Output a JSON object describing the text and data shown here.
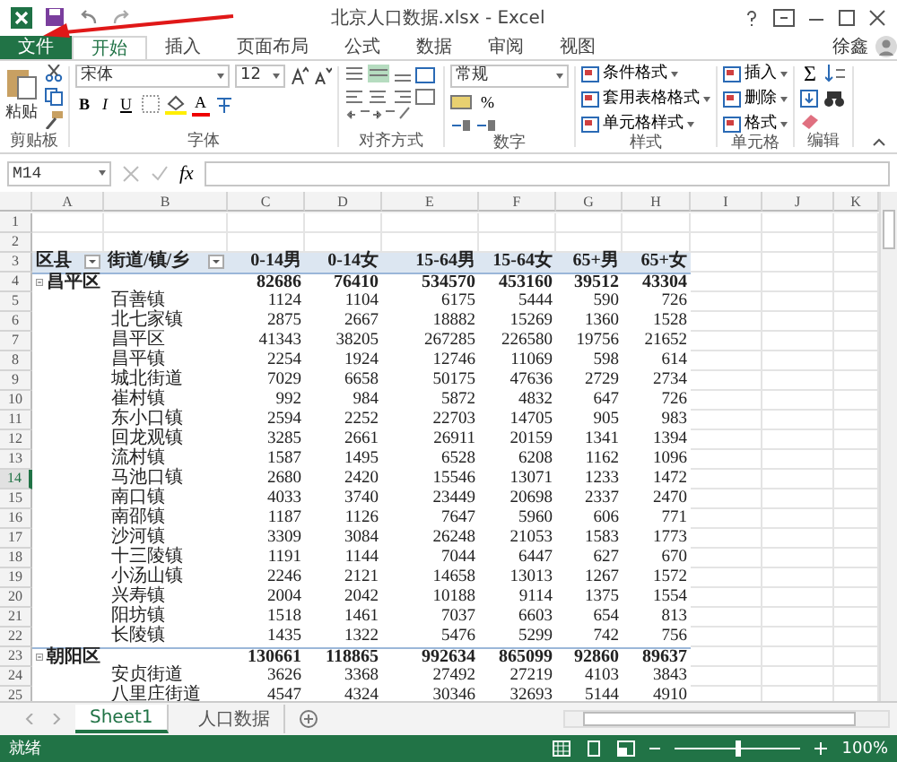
{
  "window": {
    "title": "北京人口数据.xlsx - Excel",
    "user": "徐鑫"
  },
  "tabs": [
    {
      "label": "文件",
      "kind": "file",
      "selected": false
    },
    {
      "label": "开始",
      "kind": "tab",
      "selected": true
    },
    {
      "label": "插入",
      "kind": "tab",
      "selected": false
    },
    {
      "label": "页面布局",
      "kind": "tab",
      "selected": false
    },
    {
      "label": "公式",
      "kind": "tab",
      "selected": false
    },
    {
      "label": "数据",
      "kind": "tab",
      "selected": false
    },
    {
      "label": "审阅",
      "kind": "tab",
      "selected": false
    },
    {
      "label": "视图",
      "kind": "tab",
      "selected": false
    }
  ],
  "ribbon": {
    "groups": [
      {
        "label": "剪贴板",
        "kind": "clipboard",
        "items": [
          "粘贴"
        ]
      },
      {
        "label": "字体",
        "kind": "font",
        "font": "宋体",
        "size": "12",
        "buttons": [
          "B",
          "I",
          "U"
        ],
        "color_button": "A"
      },
      {
        "label": "对齐方式",
        "kind": "align"
      },
      {
        "label": "数字",
        "kind": "number",
        "format": "常规",
        "buttons": [
          "%"
        ]
      },
      {
        "label": "样式",
        "kind": "list",
        "items": [
          "条件格式",
          "套用表格格式",
          "单元格样式"
        ]
      },
      {
        "label": "单元格",
        "kind": "list",
        "items": [
          "插入",
          "删除",
          "格式"
        ]
      },
      {
        "label": "编辑",
        "kind": "edit",
        "sum": "Σ"
      }
    ]
  },
  "formula_bar": {
    "name_box": "M14",
    "fx": "fx"
  },
  "sheet": {
    "columns": [
      "A",
      "B",
      "C",
      "D",
      "E",
      "F",
      "G",
      "H",
      "I",
      "J",
      "K"
    ],
    "rows": [
      {
        "number": "1",
        "kind": "blank",
        "selected": false,
        "cells": []
      },
      {
        "number": "2",
        "kind": "blank",
        "selected": false,
        "cells": []
      },
      {
        "number": "3",
        "kind": "header",
        "selected": false,
        "cells": [
          "区县",
          "街道/镇/乡",
          "0-14男",
          "0-14女",
          "15-64男",
          "15-64女",
          "65+男",
          "65+女"
        ]
      },
      {
        "number": "4",
        "kind": "group",
        "selected": false,
        "cells": [
          "昌平区",
          "",
          "82686",
          "76410",
          "534570",
          "453160",
          "39512",
          "43304"
        ]
      },
      {
        "number": "5",
        "kind": "item",
        "selected": false,
        "cells": [
          "",
          "百善镇",
          "1124",
          "1104",
          "6175",
          "5444",
          "590",
          "726"
        ]
      },
      {
        "number": "6",
        "kind": "item",
        "selected": false,
        "cells": [
          "",
          "北七家镇",
          "2875",
          "2667",
          "18882",
          "15269",
          "1360",
          "1528"
        ]
      },
      {
        "number": "7",
        "kind": "item",
        "selected": false,
        "cells": [
          "",
          "昌平区",
          "41343",
          "38205",
          "267285",
          "226580",
          "19756",
          "21652"
        ]
      },
      {
        "number": "8",
        "kind": "item",
        "selected": false,
        "cells": [
          "",
          "昌平镇",
          "2254",
          "1924",
          "12746",
          "11069",
          "598",
          "614"
        ]
      },
      {
        "number": "9",
        "kind": "item",
        "selected": false,
        "cells": [
          "",
          "城北街道",
          "7029",
          "6658",
          "50175",
          "47636",
          "2729",
          "2734"
        ]
      },
      {
        "number": "10",
        "kind": "item",
        "selected": false,
        "cells": [
          "",
          "崔村镇",
          "992",
          "984",
          "5872",
          "4832",
          "647",
          "726"
        ]
      },
      {
        "number": "11",
        "kind": "item",
        "selected": false,
        "cells": [
          "",
          "东小口镇",
          "2594",
          "2252",
          "22703",
          "14705",
          "905",
          "983"
        ]
      },
      {
        "number": "12",
        "kind": "item",
        "selected": false,
        "cells": [
          "",
          "回龙观镇",
          "3285",
          "2661",
          "26911",
          "20159",
          "1341",
          "1394"
        ]
      },
      {
        "number": "13",
        "kind": "item",
        "selected": false,
        "cells": [
          "",
          "流村镇",
          "1587",
          "1495",
          "6528",
          "6208",
          "1162",
          "1096"
        ]
      },
      {
        "number": "14",
        "kind": "item",
        "selected": true,
        "cells": [
          "",
          "马池口镇",
          "2680",
          "2420",
          "15546",
          "13071",
          "1233",
          "1472"
        ]
      },
      {
        "number": "15",
        "kind": "item",
        "selected": false,
        "cells": [
          "",
          "南口镇",
          "4033",
          "3740",
          "23449",
          "20698",
          "2337",
          "2470"
        ]
      },
      {
        "number": "16",
        "kind": "item",
        "selected": false,
        "cells": [
          "",
          "南邵镇",
          "1187",
          "1126",
          "7647",
          "5960",
          "606",
          "771"
        ]
      },
      {
        "number": "17",
        "kind": "item",
        "selected": false,
        "cells": [
          "",
          "沙河镇",
          "3309",
          "3084",
          "26248",
          "21053",
          "1583",
          "1773"
        ]
      },
      {
        "number": "18",
        "kind": "item",
        "selected": false,
        "cells": [
          "",
          "十三陵镇",
          "1191",
          "1144",
          "7044",
          "6447",
          "627",
          "670"
        ]
      },
      {
        "number": "19",
        "kind": "item",
        "selected": false,
        "cells": [
          "",
          "小汤山镇",
          "2246",
          "2121",
          "14658",
          "13013",
          "1267",
          "1572"
        ]
      },
      {
        "number": "20",
        "kind": "item",
        "selected": false,
        "cells": [
          "",
          "兴寿镇",
          "2004",
          "2042",
          "10188",
          "9114",
          "1375",
          "1554"
        ]
      },
      {
        "number": "21",
        "kind": "item",
        "selected": false,
        "cells": [
          "",
          "阳坊镇",
          "1518",
          "1461",
          "7037",
          "6603",
          "654",
          "813"
        ]
      },
      {
        "number": "22",
        "kind": "item",
        "selected": false,
        "cells": [
          "",
          "长陵镇",
          "1435",
          "1322",
          "5476",
          "5299",
          "742",
          "756"
        ]
      },
      {
        "number": "23",
        "kind": "group",
        "selected": false,
        "cells": [
          "朝阳区",
          "",
          "130661",
          "118865",
          "992634",
          "865099",
          "92860",
          "89637"
        ]
      },
      {
        "number": "24",
        "kind": "item",
        "selected": false,
        "cells": [
          "",
          "安贞街道",
          "3626",
          "3368",
          "27492",
          "27219",
          "4103",
          "3843"
        ]
      },
      {
        "number": "25",
        "kind": "item",
        "selected": false,
        "cells": [
          "",
          "八里庄街道",
          "4547",
          "4324",
          "30346",
          "32693",
          "5144",
          "4910"
        ]
      }
    ]
  },
  "sheet_tabs": [
    {
      "label": "Sheet1",
      "selected": true
    },
    {
      "label": "人口数据",
      "selected": false
    }
  ],
  "status_bar": {
    "text": "就绪",
    "zoom": "100%",
    "level": 0.5
  }
}
